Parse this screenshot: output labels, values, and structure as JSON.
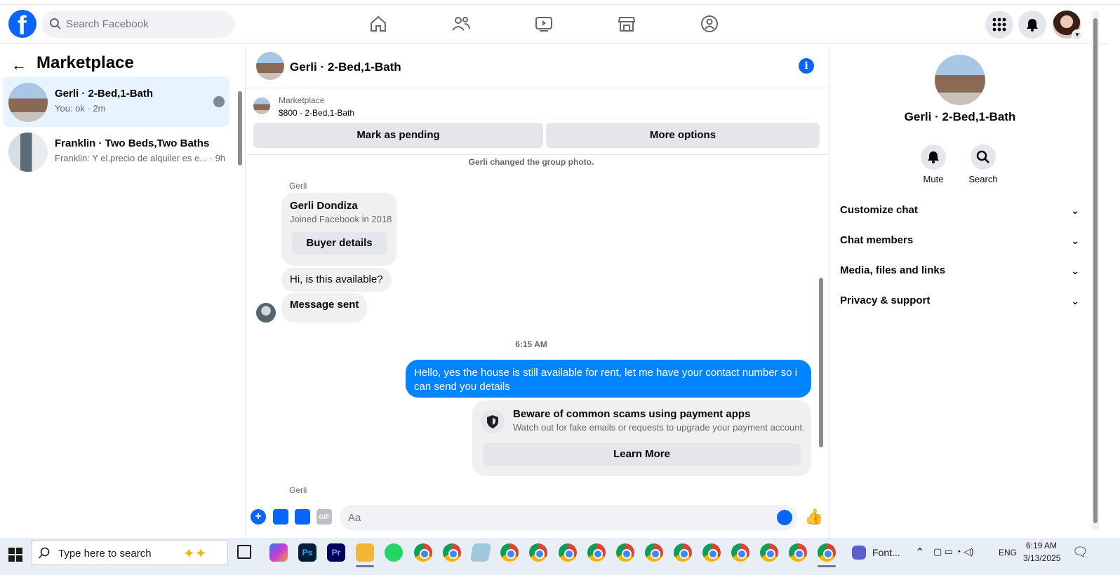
{
  "header": {
    "search_placeholder": "Search Facebook",
    "nav": [
      "home-icon",
      "friends-icon",
      "video-icon",
      "marketplace-icon",
      "groups-icon"
    ],
    "brand_color": "#0866ff"
  },
  "sidebar": {
    "title": "Marketplace",
    "chats": [
      {
        "name": "Gerli · 2-Bed,1-Bath",
        "preview": "You: ok · 2m",
        "active": true
      },
      {
        "name": "Franklin · Two Beds,Two Baths",
        "preview": "Franklin: Y el.precio de alquiler es e... · 9h",
        "active": false
      }
    ]
  },
  "conversation": {
    "title": "Gerli · 2-Bed,1-Bath",
    "marketplace_label": "Marketplace",
    "listing": "$800 - 2-Bed,1-Bath",
    "mark_pending": "Mark as pending",
    "more_options": "More options",
    "system_message": "Gerli changed the group photo.",
    "sender_name": "Gerli",
    "profile_card": {
      "name": "Gerli Dondiza",
      "joined": "Joined Facebook in 2018",
      "button": "Buyer details"
    },
    "incoming": [
      "Hi, is this available?",
      "Message sent"
    ],
    "timestamp": "6:15 AM",
    "outgoing": "Hello, yes the house is still available for rent, let me have your contact number so i can send you details",
    "scam_card": {
      "title": "Beware of common scams using payment apps",
      "subtitle": "Watch out for fake emails or requests to upgrade your payment account.",
      "button": "Learn More"
    },
    "sender_name_bottom": "Gerli",
    "composer_placeholder": "Aa",
    "outgoing_color": "#0084ff"
  },
  "details": {
    "name": "Gerli · 2-Bed,1-Bath",
    "mute": "Mute",
    "search": "Search",
    "sections": [
      "Customize chat",
      "Chat members",
      "Media, files and links",
      "Privacy & support"
    ]
  },
  "taskbar": {
    "search_placeholder": "Type here to search",
    "font_app": "Font...",
    "lang": "ENG",
    "time": "6:19 AM",
    "date": "3/13/2025"
  }
}
